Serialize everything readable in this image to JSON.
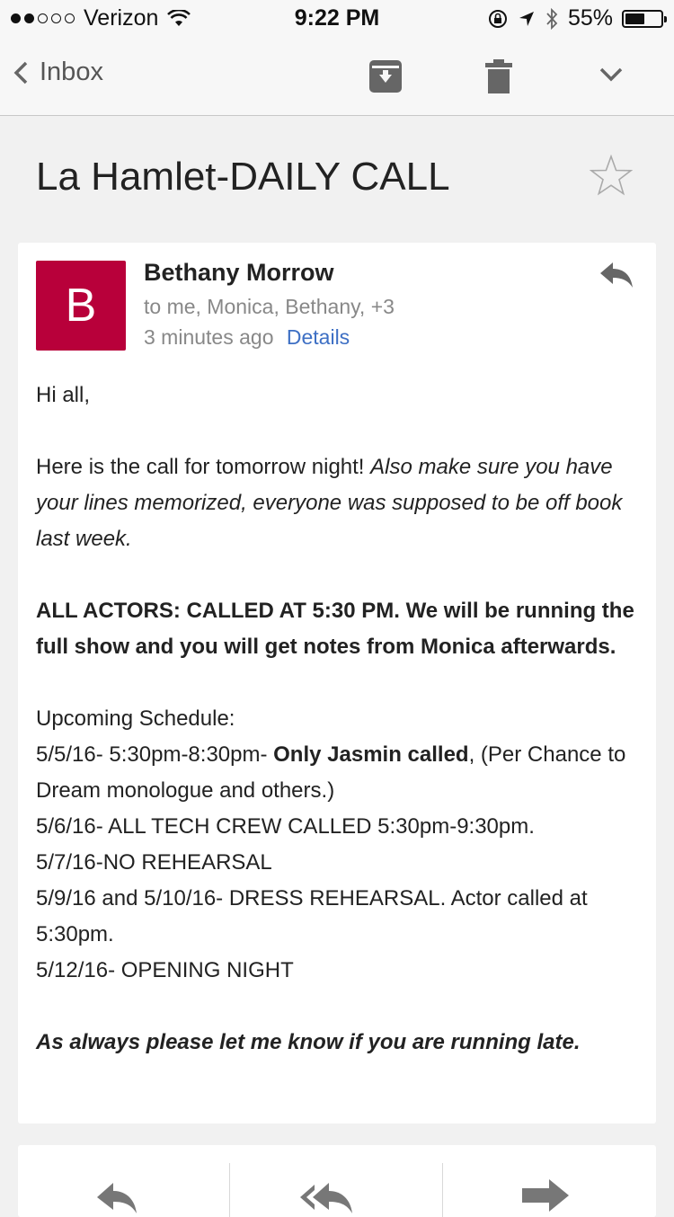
{
  "status_bar": {
    "carrier": "Verizon",
    "time": "9:22 PM",
    "battery": "55%",
    "battery_level": 0.55,
    "signal_bars_filled": 2,
    "signal_bars_total": 5
  },
  "toolbar": {
    "back_label": "Inbox",
    "icons": [
      "chevron-left-icon",
      "archive-icon",
      "trash-icon",
      "chevron-down-icon"
    ]
  },
  "subject": "La Hamlet-DAILY CALL",
  "message": {
    "avatar_letter": "B",
    "avatar_color": "#b8003a",
    "sender": "Bethany Morrow",
    "recipients": "to me, Monica, Bethany, +3",
    "time": "3 minutes ago",
    "details_label": "Details",
    "body": {
      "greeting": "Hi all,",
      "p1_normal": "Here is the call for tomorrow night! ",
      "p1_italic": "Also make sure you have your lines memorized, everyone was supposed to be off book last week.",
      "p2_bold": "ALL ACTORS: CALLED AT 5:30 PM. We will be running the full show and you will get notes from Monica afterwards.",
      "schedule_heading": "Upcoming Schedule:",
      "s1_pre": "5/5/16- 5:30pm-8:30pm- ",
      "s1_bold": "Only Jasmin called",
      "s1_post": ", (Per Chance to Dream monologue and others.)",
      "s2": "5/6/16- ALL TECH CREW CALLED 5:30pm-9:30pm.",
      "s3": "5/7/16-NO REHEARSAL",
      "s4": "5/9/16 and 5/10/16- DRESS REHEARSAL. Actor called at 5:30pm.",
      "s5": "5/12/16- OPENING NIGHT",
      "closing": "As always please let me know if you are running late."
    }
  },
  "colors": {
    "accent_link": "#3d6fc4",
    "icon_gray": "#666666"
  }
}
